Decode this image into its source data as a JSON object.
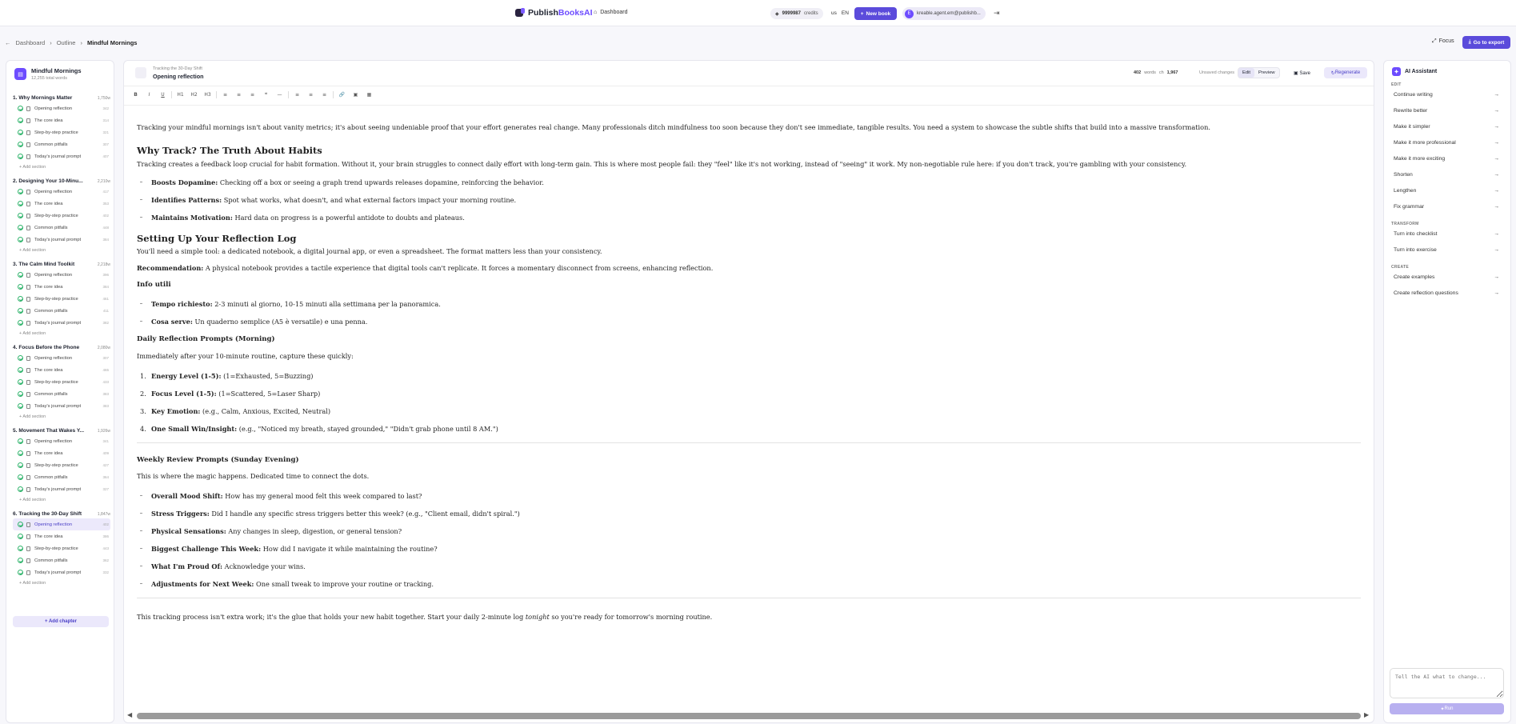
{
  "topbar": {
    "brand_part1": "Publish",
    "brand_part2": "BooksAI",
    "dashboard_label": "Dashboard",
    "credits_value": "9999987",
    "credits_label": "credits",
    "region": "us",
    "language": "EN",
    "new_book_label": "New book",
    "user_initial": "E",
    "user_email": "kreable.agent.em@publishb..."
  },
  "breadcrumb": {
    "items": [
      "Dashboard",
      "Outline",
      "Mindful Mornings"
    ]
  },
  "actions": {
    "focus_label": "Focus",
    "export_label": "Go to export"
  },
  "sidebar": {
    "book_title": "Mindful Mornings",
    "book_words": "12,255 total words",
    "add_section_label": "+ Add section",
    "add_chapter_label": "+ Add chapter",
    "chapters": [
      {
        "title": "1. Why Mornings Matter",
        "words": "1,750w",
        "sections": [
          {
            "label": "Opening reflection",
            "n": "342"
          },
          {
            "label": "The core idea",
            "n": "314"
          },
          {
            "label": "Step-by-step practice",
            "n": "321"
          },
          {
            "label": "Common pitfalls",
            "n": "307"
          },
          {
            "label": "Today's journal prompt",
            "n": "407"
          }
        ]
      },
      {
        "title": "2. Designing Your 10-Minu...",
        "words": "2,210w",
        "sections": [
          {
            "label": "Opening reflection",
            "n": "417"
          },
          {
            "label": "The core idea",
            "n": "353"
          },
          {
            "label": "Step-by-step practice",
            "n": "402"
          },
          {
            "label": "Common pitfalls",
            "n": "448"
          },
          {
            "label": "Today's journal prompt",
            "n": "384"
          }
        ]
      },
      {
        "title": "3. The Calm Mind Toolkit",
        "words": "2,218w",
        "sections": [
          {
            "label": "Opening reflection",
            "n": "396"
          },
          {
            "label": "The core idea",
            "n": "384"
          },
          {
            "label": "Step-by-step practice",
            "n": "461"
          },
          {
            "label": "Common pitfalls",
            "n": "411"
          },
          {
            "label": "Today's journal prompt",
            "n": "382"
          }
        ]
      },
      {
        "title": "4. Focus Before the Phone",
        "words": "2,080w",
        "sections": [
          {
            "label": "Opening reflection",
            "n": "307"
          },
          {
            "label": "The core idea",
            "n": "465"
          },
          {
            "label": "Step-by-step practice",
            "n": "433"
          },
          {
            "label": "Common pitfalls",
            "n": "383"
          },
          {
            "label": "Today's journal prompt",
            "n": "383"
          }
        ]
      },
      {
        "title": "5. Movement That Wakes Y...",
        "words": "1,926w",
        "sections": [
          {
            "label": "Opening reflection",
            "n": "341"
          },
          {
            "label": "The core idea",
            "n": "409"
          },
          {
            "label": "Step-by-step practice",
            "n": "427"
          },
          {
            "label": "Common pitfalls",
            "n": "364"
          },
          {
            "label": "Today's journal prompt",
            "n": "327"
          }
        ]
      },
      {
        "title": "6. Tracking the 30-Day Shift",
        "words": "1,847w",
        "sections": [
          {
            "label": "Opening reflection",
            "n": "402"
          },
          {
            "label": "The core idea",
            "n": "386"
          },
          {
            "label": "Step-by-step practice",
            "n": "443"
          },
          {
            "label": "Common pitfalls",
            "n": "362"
          },
          {
            "label": "Today's journal prompt",
            "n": "332"
          }
        ]
      }
    ]
  },
  "editor": {
    "kicker": "Tracking the 30-Day Shift",
    "title": "Opening reflection",
    "words_value": "402",
    "words_label": "words",
    "chars_label": "ch",
    "chars_value": "1,967",
    "unsaved": "Unsaved changes",
    "edit_label": "Edit",
    "preview_label": "Preview",
    "save_label": "Save",
    "regenerate_label": "Regenerate",
    "toolbar": [
      "B",
      "I",
      "U",
      "H1",
      "H2",
      "H3",
      "≡",
      "≡",
      "≡",
      "❝",
      "—",
      "≡",
      "≡",
      "≡",
      "🔗",
      "▣",
      "▦"
    ]
  },
  "content": {
    "p1": "Tracking your mindful mornings isn't about vanity metrics; it's about seeing undeniable proof that your effort generates real change. Many professionals ditch mindfulness too soon because they don't see immediate, tangible results. You need a system to showcase the subtle shifts that build into a massive transformation.",
    "h_why": "Why Track? The Truth About Habits",
    "p2": "Tracking creates a feedback loop crucial for habit formation. Without it, your brain struggles to connect daily effort with long-term gain. This is where most people fail: they \"feel\" like it's not working, instead of \"seeing\" it work. My non-negotiable rule here: if you don't track, you're gambling with your consistency.",
    "bullets1": [
      {
        "b": "Boosts Dopamine:",
        "t": " Checking off a box or seeing a graph trend upwards releases dopamine, reinforcing the behavior."
      },
      {
        "b": "Identifies Patterns:",
        "t": " Spot what works, what doesn't, and what external factors impact your morning routine."
      },
      {
        "b": "Maintains Motivation:",
        "t": " Hard data on progress is a powerful antidote to doubts and plateaus."
      }
    ],
    "h_setup": "Setting Up Your Reflection Log",
    "p3": "You'll need a simple tool: a dedicated notebook, a digital journal app, or even a spreadsheet. The format matters less than your consistency.",
    "p4_b": "Recommendation:",
    "p4_t": " A physical notebook provides a tactile experience that digital tools can't replicate. It forces a momentary disconnect from screens, enhancing reflection.",
    "h_info": "Info utili",
    "bullets2": [
      {
        "b": "Tempo richiesto:",
        "t": " 2-3 minuti al giorno, 10-15 minuti alla settimana per la panoramica."
      },
      {
        "b": "Cosa serve:",
        "t": " Un quaderno semplice (A5 è versatile) e una penna."
      }
    ],
    "h_daily": "Daily Reflection Prompts (Morning)",
    "p5": "Immediately after your 10-minute routine, capture these quickly:",
    "ordered": [
      {
        "n": "1.",
        "b": "Energy Level (1-5):",
        "t": " (1=Exhausted, 5=Buzzing)"
      },
      {
        "n": "2.",
        "b": "Focus Level (1-5):",
        "t": " (1=Scattered, 5=Laser Sharp)"
      },
      {
        "n": "3.",
        "b": "Key Emotion:",
        "t": " (e.g., Calm, Anxious, Excited, Neutral)"
      },
      {
        "n": "4.",
        "b": "One Small Win/Insight:",
        "t": " (e.g., \"Noticed my breath, stayed grounded,\" \"Didn't grab phone until 8 AM.\")"
      }
    ],
    "h_weekly": "Weekly Review Prompts (Sunday Evening)",
    "p6": "This is where the magic happens. Dedicated time to connect the dots.",
    "bullets3": [
      {
        "b": "Overall Mood Shift:",
        "t": " How has my general mood felt this week compared to last?"
      },
      {
        "b": "Stress Triggers:",
        "t": " Did I handle any specific stress triggers better this week? (e.g., \"Client email, didn't spiral.\")"
      },
      {
        "b": "Physical Sensations:",
        "t": " Any changes in sleep, digestion, or general tension?"
      },
      {
        "b": "Biggest Challenge This Week:",
        "t": " How did I navigate it while maintaining the routine?"
      },
      {
        "b": "What I'm Proud Of:",
        "t": " Acknowledge your wins."
      },
      {
        "b": "Adjustments for Next Week:",
        "t": " One small tweak to improve your routine or tracking."
      }
    ],
    "p7_a": "This tracking process isn't extra work; it's the glue that holds your new habit together. Start your daily 2-minute log ",
    "p7_i": "tonight",
    "p7_b": " so you're ready for tomorrow's morning routine."
  },
  "assistant": {
    "title": "AI Assistant",
    "group_edit": "EDIT",
    "edit_items": [
      "Continue writing",
      "Rewrite better",
      "Make it simpler",
      "Make it more professional",
      "Make it more exciting",
      "Shorten",
      "Lengthen",
      "Fix grammar"
    ],
    "group_transform": "TRANSFORM",
    "transform_items": [
      "Turn into checklist",
      "Turn into exercise"
    ],
    "group_create": "CREATE",
    "create_items": [
      "Create examples",
      "Create reflection questions"
    ],
    "input_placeholder": "Tell the AI what to change...",
    "run_label": "Run"
  },
  "colors": {
    "accent": "#5b4bdb",
    "success": "#2fb36b",
    "active_bg": "#ece9fb"
  }
}
